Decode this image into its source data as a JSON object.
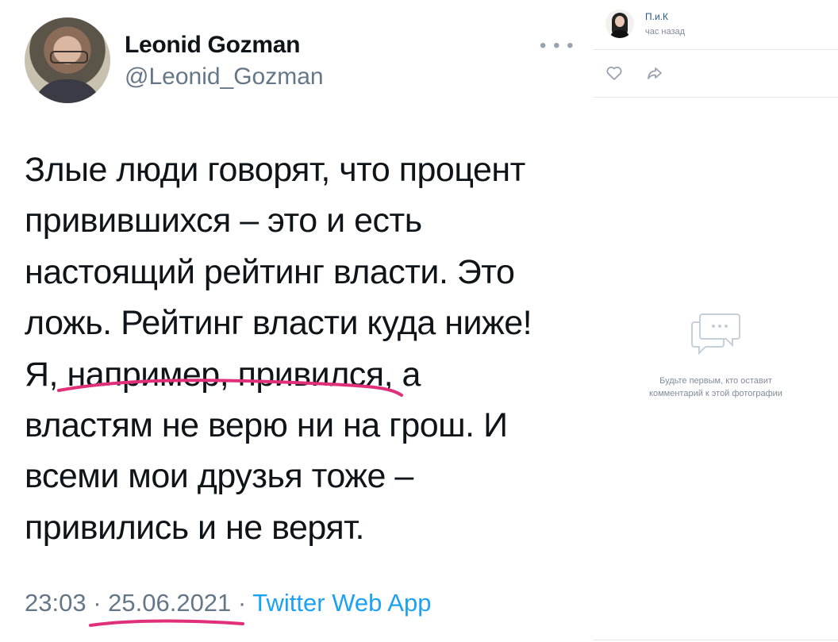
{
  "tweet": {
    "author_name": "Leonid Gozman",
    "author_handle": "@Leonid_Gozman",
    "more_icon": "ellipsis-icon",
    "text_lines": [
      "Злые люди говорят, что процент",
      "привившихся – это и есть",
      "настоящий рейтинг власти. Это",
      "ложь. Рейтинг власти куда ниже!",
      "Я, например, привился, а",
      "властям не верю ни на грош. И",
      "всеми мои друзья тоже –",
      "привились и не верят."
    ],
    "time": "23:03",
    "sep1": " · ",
    "date": "25.06.2021",
    "sep2": " · ",
    "app": "Twitter Web App",
    "highlight_color": "#e0307a"
  },
  "panel": {
    "user_name": "П.и.К",
    "time_ago": "час назад",
    "like_icon": "heart-icon",
    "share_icon": "share-arrow-icon",
    "comments_icon": "comments-icon",
    "empty_comments_line1": "Будьте первым, кто оставит",
    "empty_comments_line2": "комментарий к этой фотографии"
  }
}
